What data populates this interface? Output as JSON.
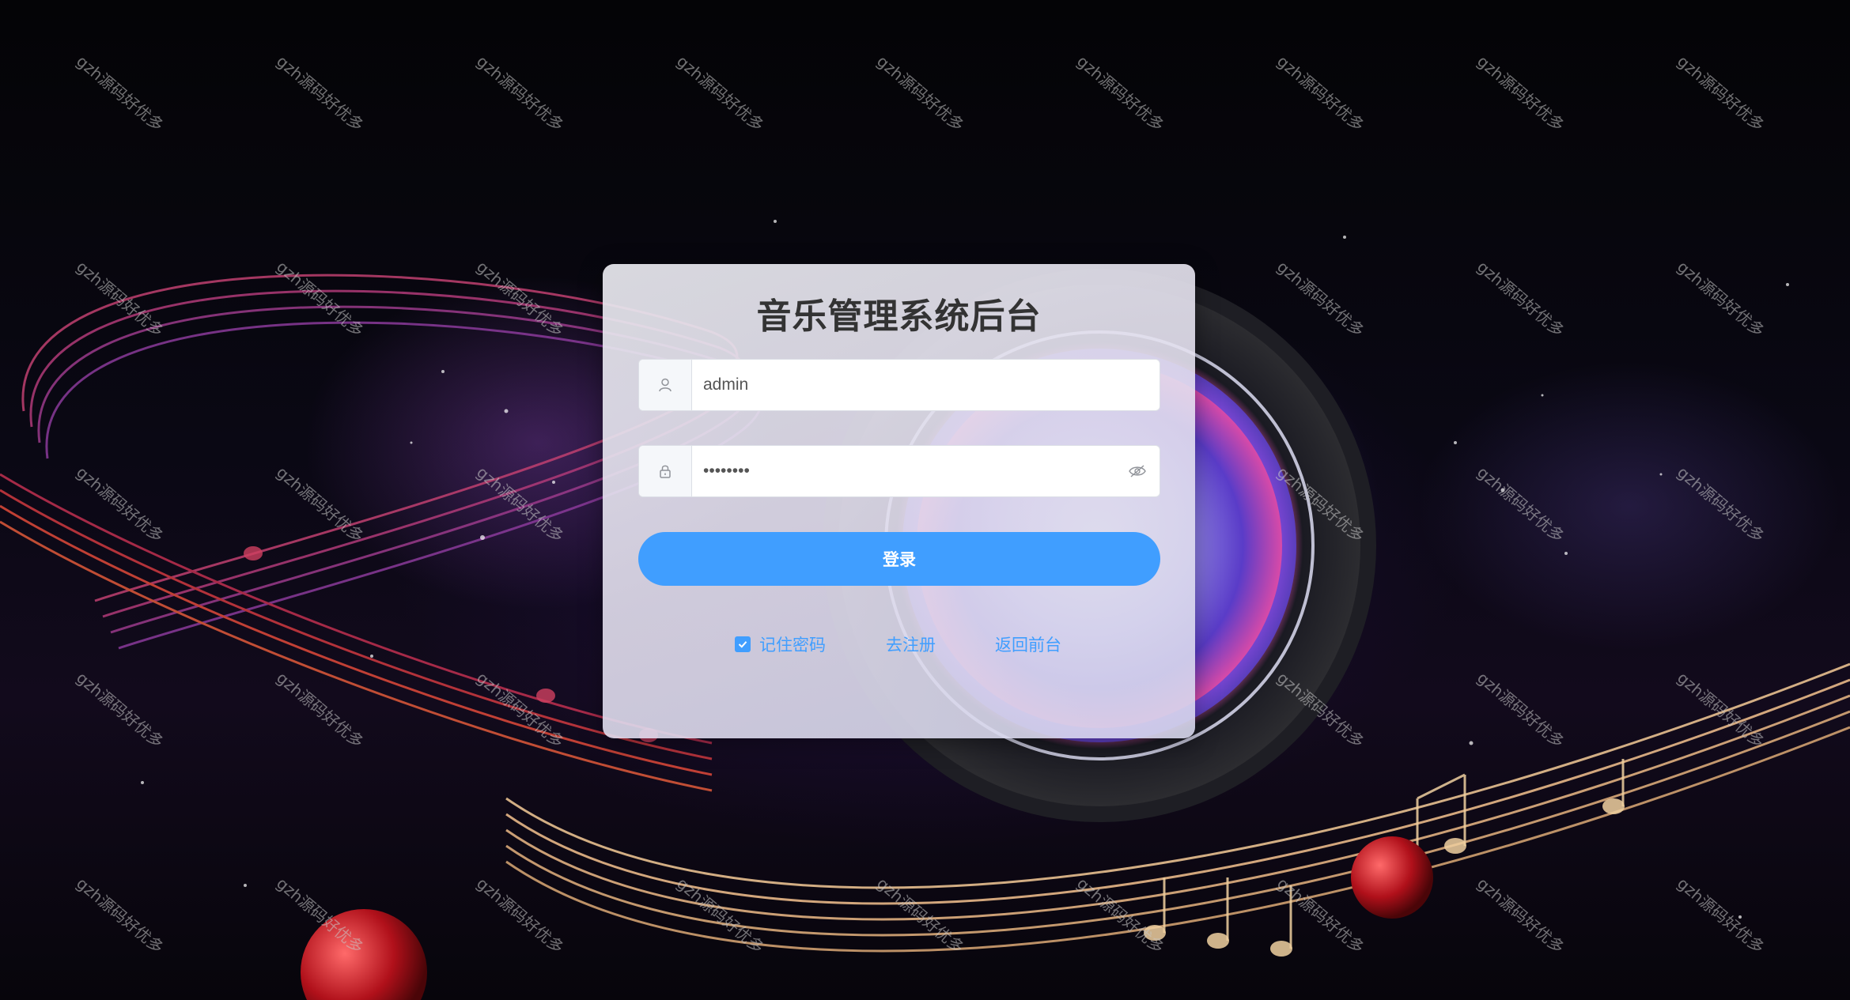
{
  "login": {
    "title": "音乐管理系统后台",
    "username": {
      "value": "admin",
      "icon": "user-icon"
    },
    "password": {
      "value": "••••••••",
      "icon": "lock-icon",
      "toggle_icon": "eye-off-icon"
    },
    "submit_label": "登录",
    "remember_label": "记住密码",
    "remember_checked": true,
    "register_label": "去注册",
    "back_label": "返回前台"
  },
  "watermark": {
    "text": "gzh源码好优多"
  },
  "colors": {
    "primary": "#409eff",
    "title": "#333333",
    "card_bg": "#e6e6ee"
  }
}
